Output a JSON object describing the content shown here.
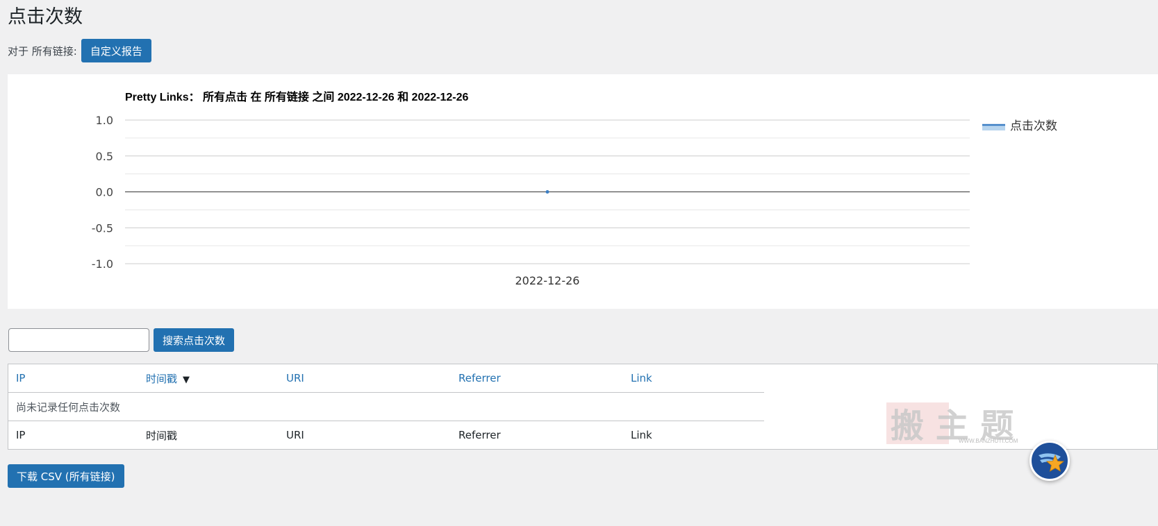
{
  "page": {
    "title": "点击次数"
  },
  "filter": {
    "label": "对于 所有链接:",
    "custom_report_button": "自定义报告"
  },
  "chart_data": {
    "type": "line",
    "title": "Pretty Links： 所有点击 在 所有链接 之间 2022-12-26 和 2022-12-26",
    "categories": [
      "2022-12-26"
    ],
    "series": [
      {
        "name": "点击次数",
        "values": [
          0
        ],
        "color": "#3c7fc4"
      }
    ],
    "ylim": [
      -1.0,
      1.0
    ],
    "yticks": [
      "1.0",
      "0.5",
      "0.0",
      "-0.5",
      "-1.0"
    ],
    "grid": true,
    "legend_position": "right"
  },
  "search": {
    "placeholder": "",
    "button": "搜索点击次数"
  },
  "table": {
    "columns": [
      "IP",
      "时间戳",
      "URI",
      "Referrer",
      "Link"
    ],
    "sort_indicator": "▼",
    "empty_message": "尚未记录任何点击次数",
    "footer": [
      "IP",
      "时间戳",
      "URI",
      "Referrer",
      "Link"
    ]
  },
  "download": {
    "button": "下载 CSV (所有链接)"
  },
  "watermark": {
    "text": "搬 主 题",
    "url": "WWW.BANZHUTI.COM"
  },
  "icons": {
    "fab": "star-icon"
  },
  "colors": {
    "accent": "#2271b1",
    "series": "#3c7fc4",
    "fab": "#1e4f9a",
    "star": "#f5a623"
  }
}
